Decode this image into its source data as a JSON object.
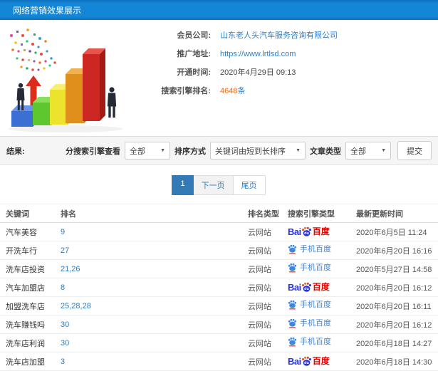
{
  "header": {
    "title": "网络营销效果展示"
  },
  "info": {
    "company_label": "会员公司:",
    "company_value": "山东老人头汽车服务咨询有限公司",
    "url_label": "推广地址:",
    "url_value": "https://www.lrtlsd.com",
    "opened_label": "开通时间:",
    "opened_value": "2020年4月29日 09:13",
    "rank_label": "搜索引擎排名:",
    "rank_count": "4648",
    "rank_unit": "条"
  },
  "filters": {
    "result_label": "结果:",
    "engine_label": "分搜索引擎查看",
    "engine_selected": "全部",
    "sort_label": "排序方式",
    "sort_selected": "关键词由短到长排序",
    "article_label": "文章类型",
    "article_selected": "全部",
    "submit_label": "提交"
  },
  "pagination": {
    "current": "1",
    "next_label": "下一页",
    "last_label": "尾页"
  },
  "table": {
    "headers": [
      "关键词",
      "排名",
      "排名类型",
      "搜索引擎类型",
      "最新更新时间"
    ],
    "rows": [
      {
        "keyword": "汽车美容",
        "rank": "9",
        "rank_type": "云网站",
        "engine": "baidu-pc",
        "updated": "2020年6月5日 11:24"
      },
      {
        "keyword": "开洗车行",
        "rank": "27",
        "rank_type": "云网站",
        "engine": "baidu-mobile",
        "updated": "2020年6月20日 16:16"
      },
      {
        "keyword": "洗车店投资",
        "rank": "21,26",
        "rank_type": "云网站",
        "engine": "baidu-mobile",
        "updated": "2020年5月27日 14:58"
      },
      {
        "keyword": "汽车加盟店",
        "rank": "8",
        "rank_type": "云网站",
        "engine": "baidu-pc",
        "updated": "2020年6月20日 16:12"
      },
      {
        "keyword": "加盟洗车店",
        "rank": "25,28,28",
        "rank_type": "云网站",
        "engine": "baidu-mobile",
        "updated": "2020年6月20日 16:11"
      },
      {
        "keyword": "洗车赚钱吗",
        "rank": "30",
        "rank_type": "云网站",
        "engine": "baidu-mobile",
        "updated": "2020年6月20日 16:12"
      },
      {
        "keyword": "洗车店利润",
        "rank": "30",
        "rank_type": "云网站",
        "engine": "baidu-mobile",
        "updated": "2020年6月18日 14:27"
      },
      {
        "keyword": "洗车店加盟",
        "rank": "3",
        "rank_type": "云网站",
        "engine": "baidu-pc",
        "updated": "2020年6月18日 14:30"
      }
    ]
  },
  "engines": {
    "baidu_pc": {
      "prefix": "Bai",
      "paw_text": "du",
      "suffix": "百度"
    },
    "baidu_mobile": {
      "label": "手机百度"
    }
  },
  "colors": {
    "header_bg": "#1486d6",
    "link_blue": "#2f7ec7",
    "highlight_orange": "#ff6600",
    "pagination_active_blue": "#337ab7",
    "baidu_blue": "#2a32dd",
    "baidu_red": "#e10601",
    "mobile_baidu_blue": "#3f86dd",
    "filter_bar_bg": "#f5f5f5"
  }
}
